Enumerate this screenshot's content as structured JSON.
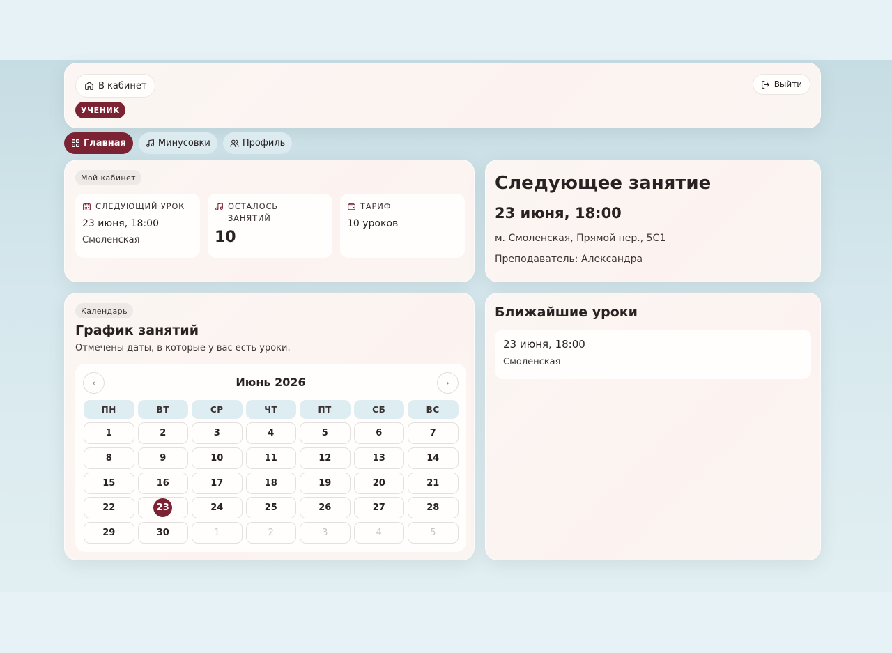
{
  "header": {
    "cabinet_label": "В кабинет",
    "logout_label": "Выйти",
    "role_badge": "УЧЕНИК"
  },
  "tabs": [
    {
      "label": "Главная",
      "active": true,
      "icon": "grid-icon"
    },
    {
      "label": "Минусовки",
      "active": false,
      "icon": "music-note-icon"
    },
    {
      "label": "Профиль",
      "active": false,
      "icon": "users-icon"
    }
  ],
  "cabinet": {
    "chip": "Мой кабинет",
    "next_lesson": {
      "label": "СЛЕДУЮЩИЙ УРОК",
      "date": "23 июня, 18:00",
      "place": "Смоленская",
      "icon": "calendar-icon"
    },
    "remaining": {
      "label_line1": "ОСТАЛОСЬ",
      "label_line2": "ЗАНЯТИЙ",
      "value": "10",
      "icon": "music-note-icon"
    },
    "tariff": {
      "label": "ТАРИФ",
      "value": "10 уроков",
      "icon": "wallet-icon"
    }
  },
  "next_session": {
    "title": "Следующее занятие",
    "date": "23 июня, 18:00",
    "address": "м. Смоленская, Прямой пер., 5С1",
    "teacher": "Преподаватель: Александра"
  },
  "calendar": {
    "chip": "Календарь",
    "title": "График занятий",
    "description": "Отмечены даты, в которые у вас есть уроки.",
    "month": "Июнь 2026",
    "prev": "‹",
    "next": "›",
    "weekdays": [
      "ПН",
      "ВТ",
      "СР",
      "ЧТ",
      "ПТ",
      "СБ",
      "ВС"
    ],
    "days": [
      {
        "d": "1"
      },
      {
        "d": "2"
      },
      {
        "d": "3"
      },
      {
        "d": "4"
      },
      {
        "d": "5"
      },
      {
        "d": "6"
      },
      {
        "d": "7"
      },
      {
        "d": "8"
      },
      {
        "d": "9"
      },
      {
        "d": "10"
      },
      {
        "d": "11"
      },
      {
        "d": "12"
      },
      {
        "d": "13"
      },
      {
        "d": "14"
      },
      {
        "d": "15"
      },
      {
        "d": "16"
      },
      {
        "d": "17"
      },
      {
        "d": "18"
      },
      {
        "d": "19"
      },
      {
        "d": "20"
      },
      {
        "d": "21"
      },
      {
        "d": "22"
      },
      {
        "d": "23",
        "marked": true
      },
      {
        "d": "24"
      },
      {
        "d": "25"
      },
      {
        "d": "26"
      },
      {
        "d": "27"
      },
      {
        "d": "28"
      },
      {
        "d": "29"
      },
      {
        "d": "30"
      },
      {
        "d": "1",
        "muted": true
      },
      {
        "d": "2",
        "muted": true
      },
      {
        "d": "3",
        "muted": true
      },
      {
        "d": "4",
        "muted": true
      },
      {
        "d": "5",
        "muted": true
      }
    ]
  },
  "upcoming": {
    "title": "Ближайшие уроки",
    "items": [
      {
        "date": "23 июня, 18:00",
        "place": "Смоленская"
      }
    ]
  },
  "colors": {
    "accent": "#7b2233",
    "background": "#e6f2f6",
    "card": "#fbf5f2"
  }
}
